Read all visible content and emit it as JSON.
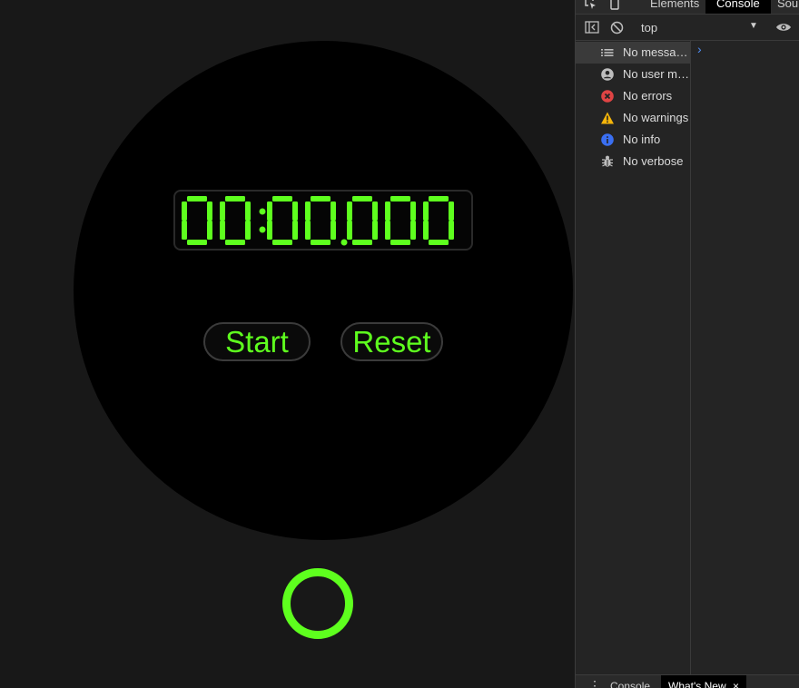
{
  "stopwatch": {
    "time": "00:00.000",
    "start_label": "Start",
    "reset_label": "Reset",
    "accent_color": "#5eff1e",
    "dial_color": "#000000",
    "background_color": "#181818"
  },
  "devtools": {
    "tabs": [
      "Elements",
      "Console",
      "Sour"
    ],
    "active_tab": "Console",
    "context": "top",
    "sidebar": [
      {
        "label": "No messages",
        "icon": "list-icon"
      },
      {
        "label": "No user messages",
        "icon": "user-icon"
      },
      {
        "label": "No errors",
        "icon": "error-icon"
      },
      {
        "label": "No warnings",
        "icon": "warning-icon"
      },
      {
        "label": "No info",
        "icon": "info-icon"
      },
      {
        "label": "No verbose",
        "icon": "bug-icon"
      }
    ],
    "prompt": "›",
    "drawer_tabs": [
      "Console",
      "What's New"
    ],
    "drawer_close": "×"
  }
}
